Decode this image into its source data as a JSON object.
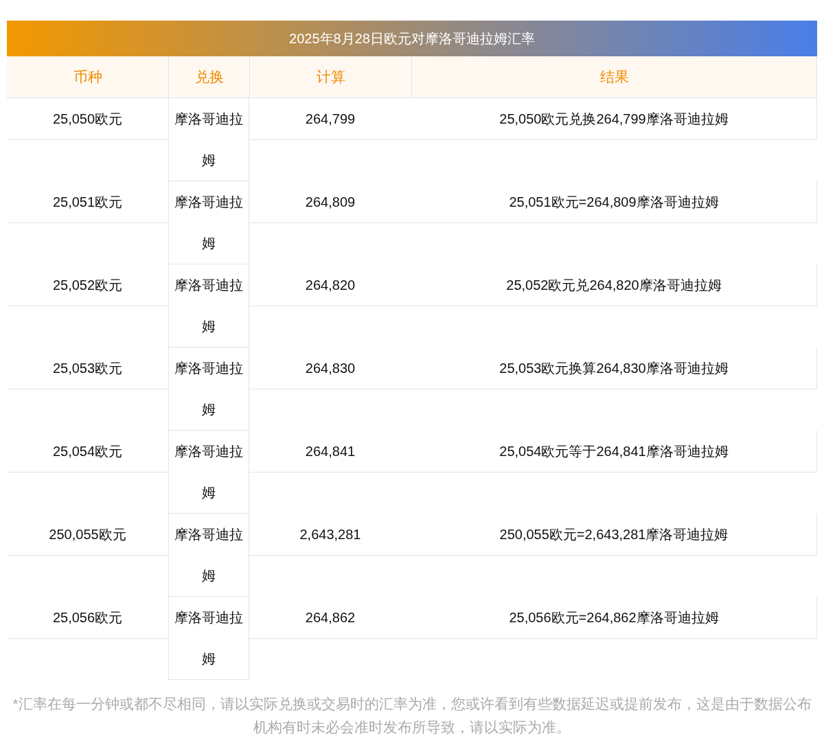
{
  "title": "2025年8月28日欧元对摩洛哥迪拉姆汇率",
  "columns": [
    "币种",
    "兑换",
    "计算",
    "结果"
  ],
  "rows": [
    {
      "currency": "25,050欧元",
      "target": "摩洛哥迪拉姆",
      "amount": "264,799",
      "result": "25,050欧元兑换264,799摩洛哥迪拉姆"
    },
    {
      "currency": "25,051欧元",
      "target": "摩洛哥迪拉姆",
      "amount": "264,809",
      "result": "25,051欧元=264,809摩洛哥迪拉姆"
    },
    {
      "currency": "25,052欧元",
      "target": "摩洛哥迪拉姆",
      "amount": "264,820",
      "result": "25,052欧元兑264,820摩洛哥迪拉姆"
    },
    {
      "currency": "25,053欧元",
      "target": "摩洛哥迪拉姆",
      "amount": "264,830",
      "result": "25,053欧元换算264,830摩洛哥迪拉姆"
    },
    {
      "currency": "25,054欧元",
      "target": "摩洛哥迪拉姆",
      "amount": "264,841",
      "result": "25,054欧元等于264,841摩洛哥迪拉姆"
    },
    {
      "currency": "250,055欧元",
      "target": "摩洛哥迪拉姆",
      "amount": "2,643,281",
      "result": "250,055欧元=2,643,281摩洛哥迪拉姆"
    },
    {
      "currency": "25,056欧元",
      "target": "摩洛哥迪拉姆",
      "amount": "264,862",
      "result": "25,056欧元=264,862摩洛哥迪拉姆"
    }
  ],
  "footnote": "*汇率在每一分钟或都不尽相同，请以实际兑换或交易时的汇率为准，您或许看到有些数据延迟或提前发布，这是由于数据公布机构有时未必会准时发布所导致，请以实际为准。"
}
